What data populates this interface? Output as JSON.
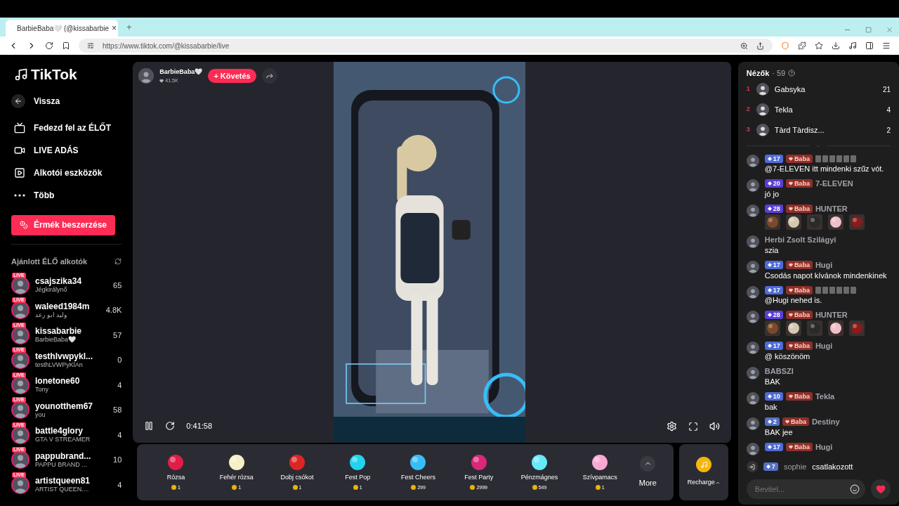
{
  "browser": {
    "tab": {
      "title": "BarbieBaba🤍 (@kissabarbie",
      "close": "×"
    },
    "new_tab": "+",
    "url": "https://www.tiktok.com/@kissabarbie/live"
  },
  "sidebar": {
    "logo": "TikTok",
    "back": "Vissza",
    "nav": [
      {
        "kind": "tv",
        "label": "Fedezd fel az ÉLŐT"
      },
      {
        "kind": "camera",
        "label": "LIVE ADÁS"
      },
      {
        "kind": "play",
        "label": "Alkotói eszközök"
      },
      {
        "kind": "more",
        "label": "Több"
      }
    ],
    "coins_button": "Érmék beszerzése",
    "section_title": "Ajánlott ÉLŐ alkotók",
    "creators": [
      {
        "name": "csajszika34",
        "sub": "Jégkirálynő",
        "count": "65",
        "badge": "LIVE"
      },
      {
        "name": "waleed1984m",
        "sub": "وليد ابو رعد",
        "count": "4.8K",
        "badge": "LIVE"
      },
      {
        "name": "kissabarbie",
        "sub": "BarbieBaba🤍",
        "count": "57",
        "badge": "LIVE"
      },
      {
        "name": "testhlvwpykl...",
        "sub": "testhLVWPyKlAn",
        "count": "0",
        "badge": "LIVE"
      },
      {
        "name": "lonetone60",
        "sub": "Tony",
        "count": "4",
        "badge": "LIVE"
      },
      {
        "name": "younotthem67",
        "sub": "you",
        "count": "58",
        "badge": "LIVE"
      },
      {
        "name": "battle4glory",
        "sub": "GTA V STREAMER",
        "count": "4",
        "badge": "LIVE"
      },
      {
        "name": "pappubrand...",
        "sub": "PAPPU BRAND ...",
        "count": "10",
        "badge": "LIVE"
      },
      {
        "name": "artistqueen81",
        "sub": "ARTIST QUEEN....",
        "count": "4",
        "badge": "LIVE"
      }
    ]
  },
  "stream": {
    "host": "BarbieBaba🤍",
    "likes": "41.5K",
    "follow": "+ Követés",
    "time": "0:41:58",
    "gifts": [
      {
        "name": "Rózsa",
        "price": "1",
        "color": "#e11d48"
      },
      {
        "name": "Fehér rózsa",
        "price": "1",
        "color": "#f5f0c8"
      },
      {
        "name": "Dobj csókot",
        "price": "1",
        "color": "#dc2626"
      },
      {
        "name": "Fest Pop",
        "price": "1",
        "color": "#22d3ee"
      },
      {
        "name": "Fest Cheers",
        "price": "299",
        "color": "#38bdf8"
      },
      {
        "name": "Fest Party",
        "price": "2999",
        "color": "#db2777"
      },
      {
        "name": "Pénzmágnes",
        "price": "549",
        "color": "#67e8f9"
      },
      {
        "name": "Szívpamacs",
        "price": "1",
        "color": "#f9a8d4"
      }
    ],
    "more": "More",
    "recharge": "Recharge"
  },
  "chat": {
    "title": "Nézők",
    "viewers": "· 59",
    "top": [
      {
        "rank": "1",
        "name": "Gabsyka",
        "count": "21"
      },
      {
        "rank": "2",
        "name": "Tekla",
        "count": "4"
      },
      {
        "rank": "3",
        "name": "Tàrd Tàrdisz...",
        "count": "2"
      }
    ],
    "messages": [
      {
        "kind": "text",
        "level": {
          "text": "17",
          "color": "#4f6bd8"
        },
        "fan": "Baba",
        "masked": true,
        "text": "@7-ELEVEN itt mindenki szűz vót."
      },
      {
        "kind": "text",
        "level": {
          "text": "20",
          "color": "#5b3fd6"
        },
        "fan": "Baba",
        "name": "7-ELEVEN",
        "text": "jó jo"
      },
      {
        "kind": "stickers",
        "level": {
          "text": "28",
          "color": "#5b3fd6"
        },
        "fan": "Baba",
        "name": "HUNTER"
      },
      {
        "kind": "text",
        "name": "Herbi Zsolt Szilágyi",
        "text": "szia"
      },
      {
        "kind": "text",
        "level": {
          "text": "17",
          "color": "#4f6bd8"
        },
        "fan": "Baba",
        "name": "Hugi",
        "text": "Csodás napot kívánok mindenkinek"
      },
      {
        "kind": "text",
        "level": {
          "text": "17",
          "color": "#4f6bd8"
        },
        "fan": "Baba",
        "masked": true,
        "text": "@Hugi nehed is."
      },
      {
        "kind": "stickers",
        "level": {
          "text": "28",
          "color": "#5b3fd6"
        },
        "fan": "Baba",
        "name": "HUNTER"
      },
      {
        "kind": "text",
        "level": {
          "text": "17",
          "color": "#4f6bd8"
        },
        "fan": "Baba",
        "name": "Hugi",
        "text": "@ köszönöm"
      },
      {
        "kind": "text",
        "name": "BABSZI",
        "text": "BAK"
      },
      {
        "kind": "text",
        "level": {
          "text": "10",
          "color": "#4f6bd8"
        },
        "fan": "Baba",
        "name": "Tekla",
        "text": "bak"
      },
      {
        "kind": "text",
        "level": {
          "text": "2",
          "color": "#5470c8"
        },
        "fan": "Baba",
        "name": "Destiny",
        "text": "BAK jee"
      },
      {
        "kind": "header",
        "level": {
          "text": "17",
          "color": "#4f6bd8"
        },
        "fan": "Baba",
        "name": "Hugi"
      }
    ],
    "join": {
      "level": {
        "text": "7",
        "color": "#5470c8"
      },
      "name": "sophie",
      "text": "csatlakozott"
    },
    "input_placeholder": "Bevitel..."
  }
}
